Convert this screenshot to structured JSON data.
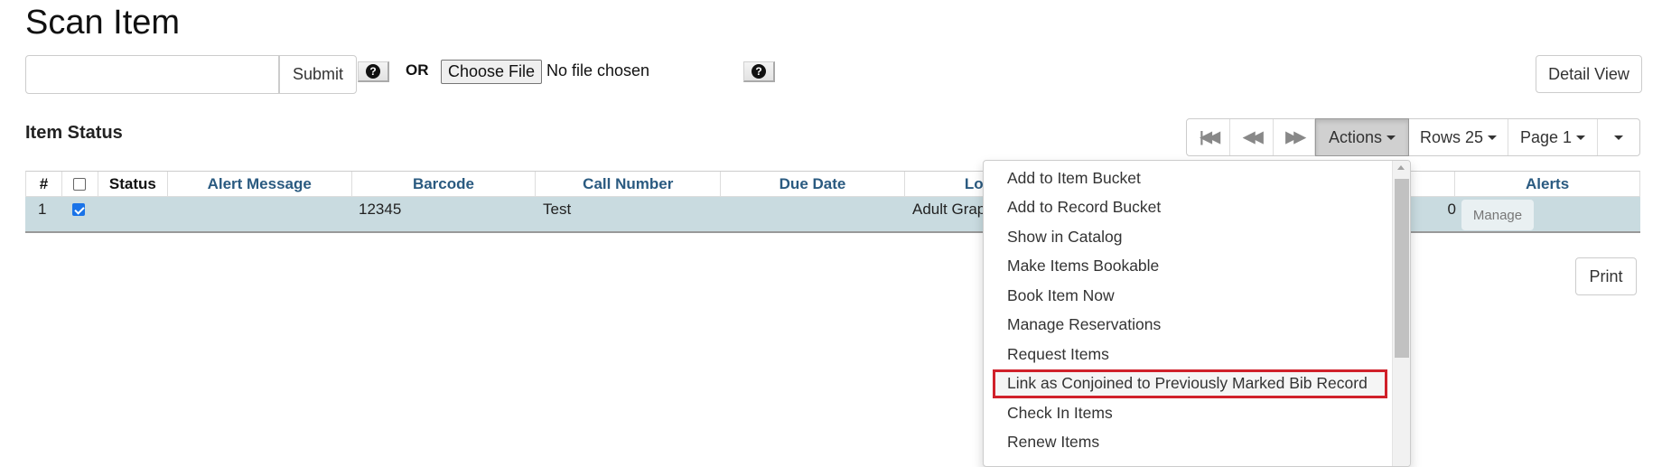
{
  "page": {
    "title": "Scan Item"
  },
  "scan": {
    "barcode_value": "",
    "barcode_placeholder": "",
    "submit_label": "Submit",
    "help_icon": "question-circle-icon",
    "or_label": "OR",
    "choose_file_label": "Choose File",
    "file_status": "No file chosen",
    "detail_view_label": "Detail View"
  },
  "item_status": {
    "title": "Item Status",
    "toolbar": {
      "first_page_icon": "first-page-icon",
      "prev_page_icon": "previous-page-icon",
      "next_page_icon": "next-page-icon",
      "actions_label": "Actions",
      "rows_label": "Rows 25",
      "page_label": "Page 1"
    },
    "columns": [
      "#",
      "",
      "Status",
      "Alert Message",
      "Barcode",
      "Call Number",
      "Due Date",
      "Location",
      "Alerts"
    ],
    "rows": [
      {
        "index": "1",
        "selected": true,
        "status": "",
        "alert_message": "",
        "barcode": "12345",
        "call_number": "Test",
        "due_date": "",
        "location": "Adult Grap",
        "alerts_count": "0",
        "manage_label": "Manage"
      }
    ],
    "print_label": "Print"
  },
  "actions_menu": {
    "items": [
      "Add to Item Bucket",
      "Add to Record Bucket",
      "Show in Catalog",
      "Make Items Bookable",
      "Book Item Now",
      "Manage Reservations",
      "Request Items",
      "Link as Conjoined to Previously Marked Bib Record",
      "Check In Items",
      "Renew Items"
    ],
    "highlighted_index": 7,
    "highlight_color": "#d0202a"
  }
}
